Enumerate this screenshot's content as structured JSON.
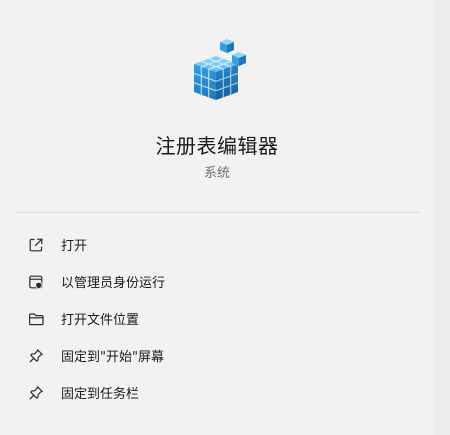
{
  "app": {
    "name": "注册表编辑器",
    "category": "系统",
    "icon": "registry-editor-icon"
  },
  "menu": {
    "items": [
      {
        "label": "打开",
        "icon": "open-external-icon"
      },
      {
        "label": "以管理员身份运行",
        "icon": "admin-shield-icon"
      },
      {
        "label": "打开文件位置",
        "icon": "folder-icon"
      },
      {
        "label": "固定到\"开始\"屏幕",
        "icon": "pin-icon"
      },
      {
        "label": "固定到任务栏",
        "icon": "pin-icon"
      }
    ]
  },
  "colors": {
    "background": "#f2f2f2",
    "icon_blue": "#2f8fd0",
    "icon_light_blue": "#58b6ec",
    "divider": "#dcdcdc"
  }
}
